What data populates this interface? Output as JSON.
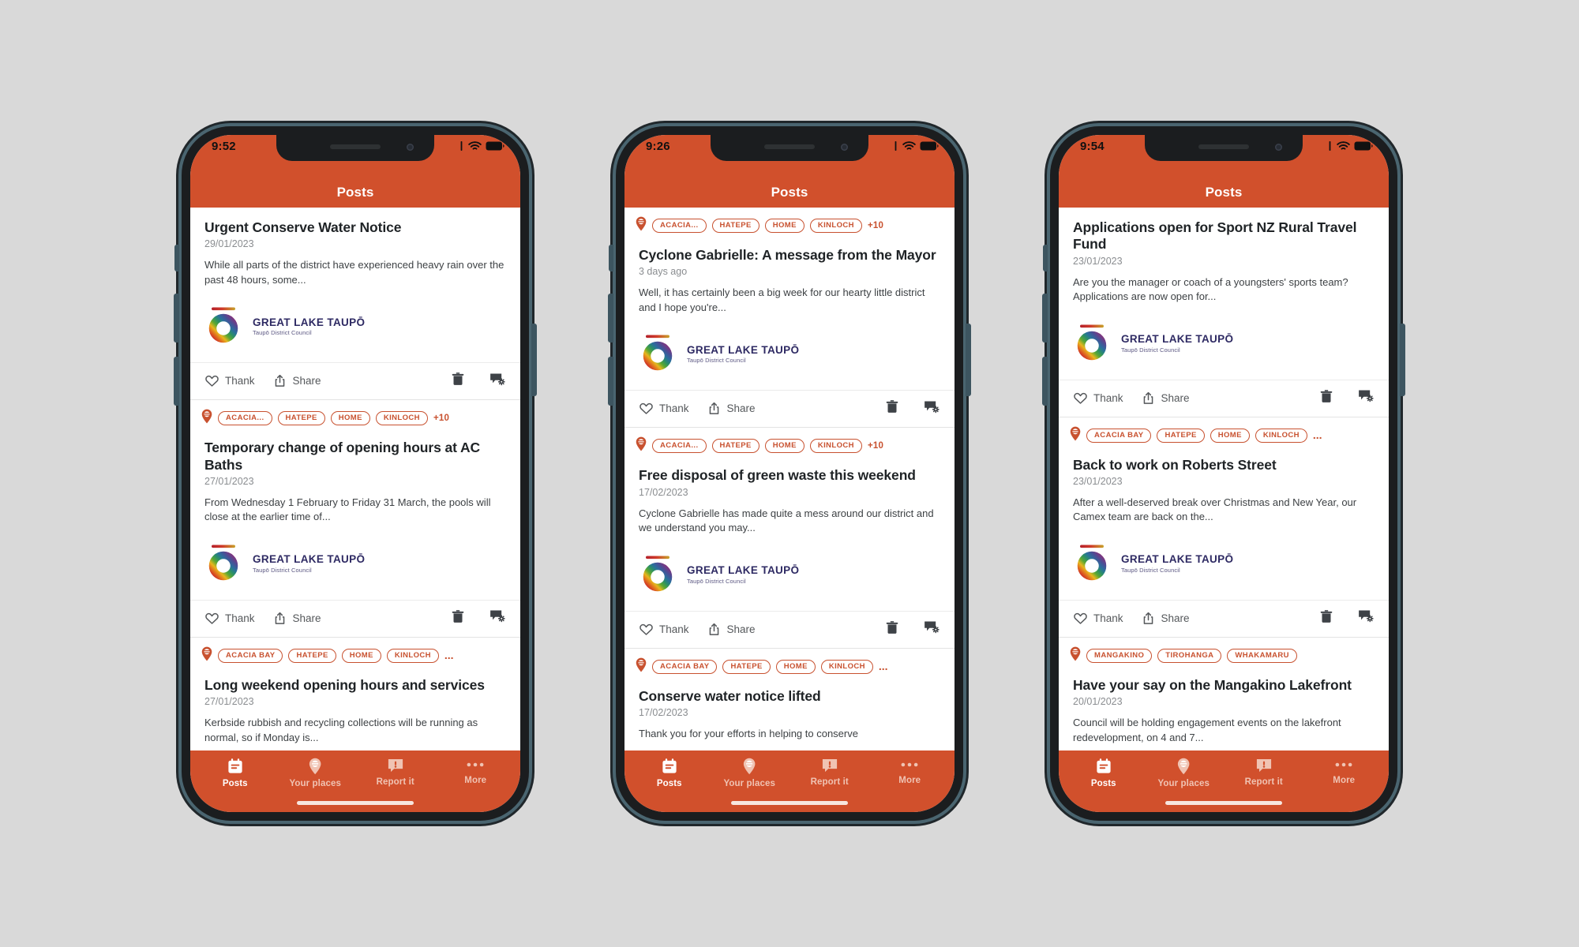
{
  "app": {
    "header_title": "Posts",
    "accent_color": "#d1502c",
    "tag_color": "#c8512f",
    "logo_main": "GREAT LAKE TAUPŌ",
    "logo_sub": "Taupō District Council",
    "thank_label": "Thank",
    "share_label": "Share",
    "thank_icon": "heart-icon",
    "share_icon": "share-icon",
    "delete_icon": "trash-icon",
    "manage_icon": "message-settings-icon",
    "pin_icon": "map-pin-icon"
  },
  "tabbar": {
    "items": [
      {
        "label": "Posts",
        "icon": "news-calendar-icon",
        "active": true
      },
      {
        "label": "Your places",
        "icon": "map-pin-icon",
        "active": false
      },
      {
        "label": "Report it",
        "icon": "report-bubble-icon",
        "active": false
      },
      {
        "label": "More",
        "icon": "ellipsis-icon",
        "active": false
      }
    ]
  },
  "phones": [
    {
      "status": {
        "time": "9:52",
        "wifi_icon": "wifi-icon",
        "battery_icon": "battery-icon",
        "signal_icon": "signal-icon"
      },
      "posts": [
        {
          "tags": null,
          "title": "Urgent Conserve Water Notice",
          "date": "29/01/2023",
          "body": "While all parts of the district have experienced heavy rain over the past 48 hours, some...",
          "has_logo": true,
          "has_actions": true
        },
        {
          "tags": {
            "list": [
              "ACACIA...",
              "HATEPE",
              "HOME",
              "KINLOCH"
            ],
            "overflow": "+10"
          },
          "title": "Temporary change of opening hours at AC Baths",
          "date": "27/01/2023",
          "body": "From Wednesday 1 February to Friday 31 March, the pools will close at the earlier time of...",
          "has_logo": true,
          "has_actions": true
        },
        {
          "tags": {
            "list": [
              "ACACIA BAY",
              "HATEPE",
              "HOME",
              "KINLOCH"
            ],
            "overflow": "..."
          },
          "title": "Long weekend opening hours and services",
          "date": "27/01/2023",
          "body": "Kerbside rubbish and recycling collections will be running as normal, so if Monday is...",
          "has_logo": false,
          "has_actions": false
        }
      ]
    },
    {
      "status": {
        "time": "9:26",
        "wifi_icon": "wifi-icon",
        "battery_icon": "battery-icon",
        "signal_icon": "signal-icon"
      },
      "posts": [
        {
          "tags": {
            "list": [
              "ACACIA...",
              "HATEPE",
              "HOME",
              "KINLOCH"
            ],
            "overflow": "+10"
          },
          "title": "Cyclone Gabrielle: A message from the Mayor",
          "date": "3 days ago",
          "body": "Well, it has certainly been a big week for our hearty little district and I hope you're...",
          "has_logo": true,
          "has_actions": true
        },
        {
          "tags": {
            "list": [
              "ACACIA...",
              "HATEPE",
              "HOME",
              "KINLOCH"
            ],
            "overflow": "+10"
          },
          "title": "Free disposal of green waste this weekend",
          "date": "17/02/2023",
          "body": "Cyclone Gabrielle has made quite a mess around our district and we understand you may...",
          "has_logo": true,
          "has_actions": true
        },
        {
          "tags": {
            "list": [
              "ACACIA BAY",
              "HATEPE",
              "HOME",
              "KINLOCH"
            ],
            "overflow": "..."
          },
          "title": "Conserve water notice lifted",
          "date": "17/02/2023",
          "body": "Thank you for your efforts in helping to conserve",
          "has_logo": false,
          "has_actions": false
        }
      ]
    },
    {
      "status": {
        "time": "9:54",
        "wifi_icon": "wifi-icon",
        "battery_icon": "battery-icon",
        "signal_icon": "signal-icon"
      },
      "posts": [
        {
          "tags": null,
          "title": "Applications open for Sport NZ Rural Travel Fund",
          "date": "23/01/2023",
          "body": "Are you the manager or coach of a youngsters' sports team? Applications are now open for...",
          "has_logo": true,
          "has_actions": true
        },
        {
          "tags": {
            "list": [
              "ACACIA BAY",
              "HATEPE",
              "HOME",
              "KINLOCH"
            ],
            "overflow": "..."
          },
          "title": "Back to work on Roberts Street",
          "date": "23/01/2023",
          "body": "After a well-deserved break over Christmas and New Year, our Camex team are back on the...",
          "has_logo": true,
          "has_actions": true
        },
        {
          "tags": {
            "list": [
              "MANGAKINO",
              "TIROHANGA",
              "WHAKAMARU"
            ],
            "overflow": null
          },
          "title": "Have your say on the Mangakino Lakefront",
          "date": "20/01/2023",
          "body": "Council will be holding engagement events on the lakefront redevelopment, on 4 and 7...",
          "has_logo": false,
          "has_actions": false
        }
      ]
    }
  ]
}
